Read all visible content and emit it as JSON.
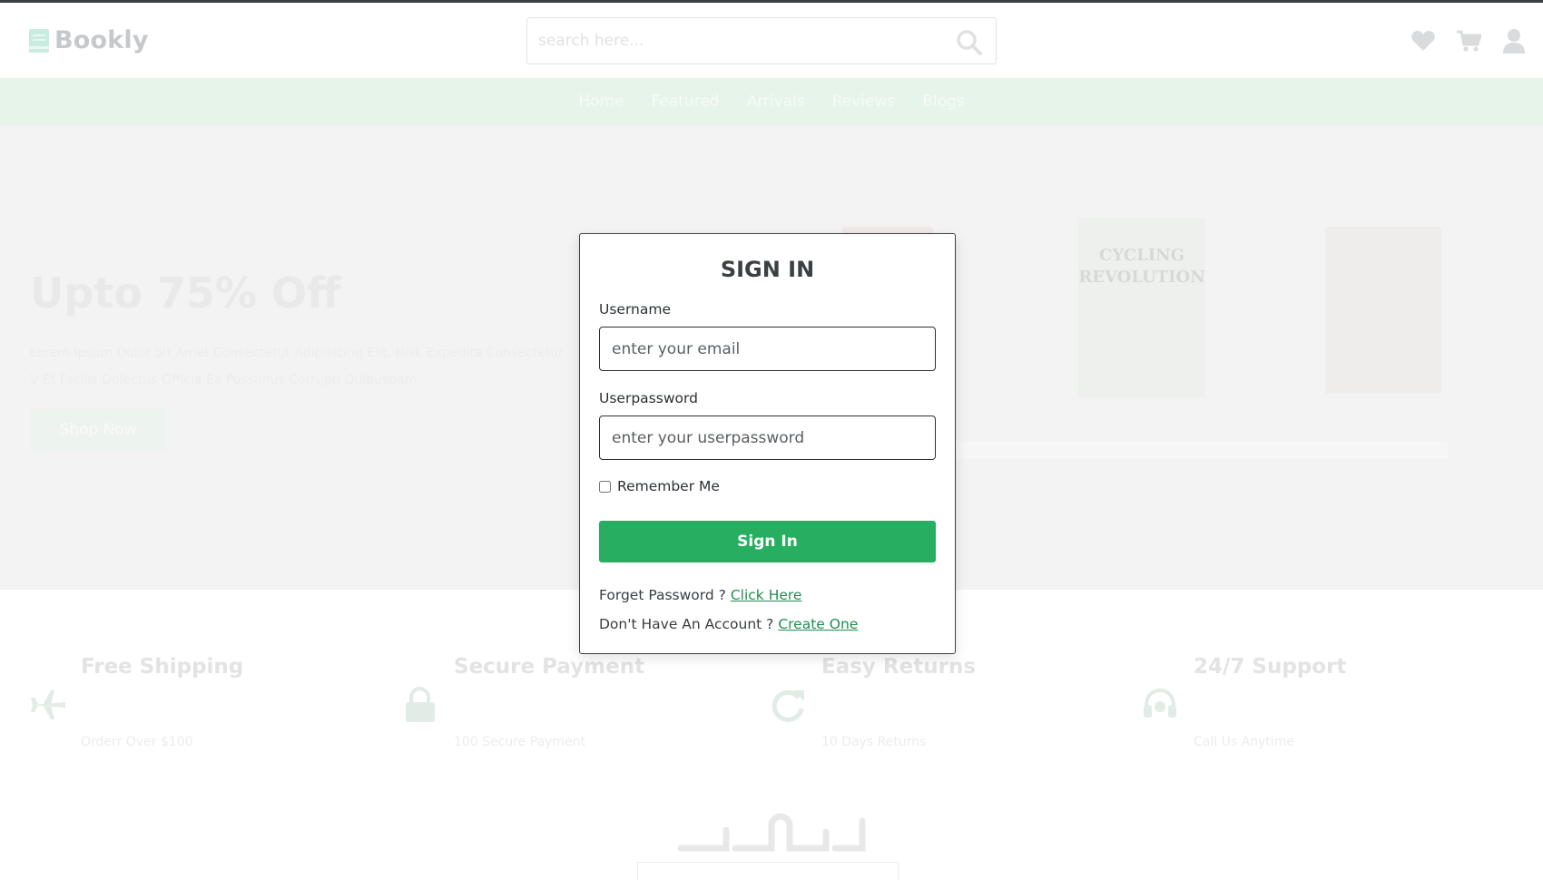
{
  "brand": {
    "name": "Bookly",
    "accent": "#27ae60"
  },
  "search": {
    "placeholder": "search here..."
  },
  "header_icons": [
    "heart-icon",
    "cart-icon",
    "user-icon"
  ],
  "nav": {
    "items": [
      "Home",
      "Featured",
      "Arrivals",
      "Reviews",
      "Blogs"
    ]
  },
  "hero": {
    "title": "Upto 75% Off",
    "text": "Lorem Ipsum Dolor Sit Amet Consectetur Adipisicing Elit. Nisi, Expedita Consectetur V Et Facilis Dolectus Officia Ea Possimus Corrupti Quibusdam.",
    "button": "Shop Now",
    "book_title": "CYCLING REVOLUTION"
  },
  "features": [
    {
      "icon": "plane-icon",
      "title": "Free Shipping",
      "sub": "Orderr Over $100"
    },
    {
      "icon": "lock-icon",
      "title": "Secure Payment",
      "sub": "100 Secure Payment"
    },
    {
      "icon": "redo-icon",
      "title": "Easy Returns",
      "sub": "10 Days Returns"
    },
    {
      "icon": "headset-icon",
      "title": "24/7 Support",
      "sub": "Call Us Anytime"
    }
  ],
  "modal": {
    "title": "SIGN IN",
    "username_label": "Username",
    "username_placeholder": "enter your email",
    "password_label": "Userpassword",
    "password_placeholder": "enter your userpassword",
    "remember_label": "Remember Me",
    "signin_button": "Sign In",
    "forgot_text": "Forget Password ?",
    "forgot_link": "Click Here",
    "account_text": "Don't Have An Account ?",
    "account_link": "Create One"
  }
}
